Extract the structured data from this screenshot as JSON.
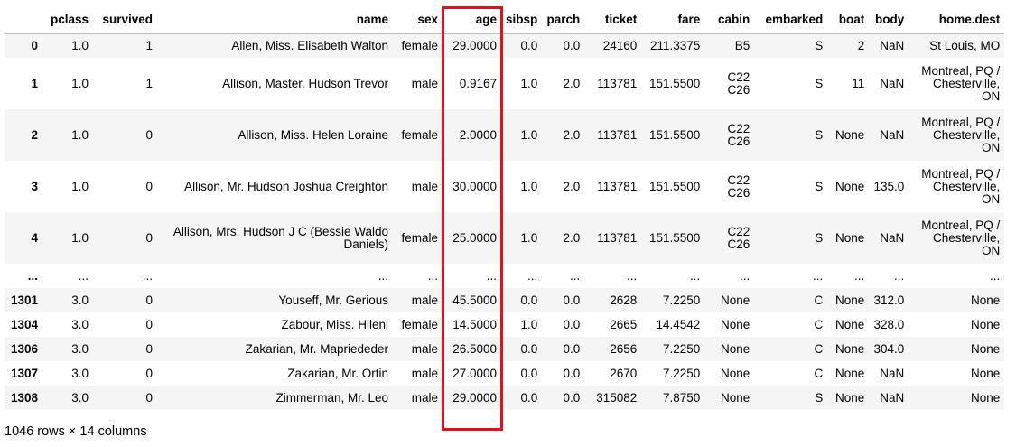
{
  "columns": [
    "",
    "pclass",
    "survived",
    "name",
    "sex",
    "age",
    "sibsp",
    "parch",
    "ticket",
    "fare",
    "cabin",
    "embarked",
    "boat",
    "body",
    "home.dest"
  ],
  "rows": [
    [
      "0",
      "1.0",
      "1",
      "Allen, Miss. Elisabeth Walton",
      "female",
      "29.0000",
      "0.0",
      "0.0",
      "24160",
      "211.3375",
      "B5",
      "S",
      "2",
      "NaN",
      "St Louis, MO"
    ],
    [
      "1",
      "1.0",
      "1",
      "Allison, Master. Hudson Trevor",
      "male",
      "0.9167",
      "1.0",
      "2.0",
      "113781",
      "151.5500",
      "C22 C26",
      "S",
      "11",
      "NaN",
      "Montreal, PQ / Chesterville, ON"
    ],
    [
      "2",
      "1.0",
      "0",
      "Allison, Miss. Helen Loraine",
      "female",
      "2.0000",
      "1.0",
      "2.0",
      "113781",
      "151.5500",
      "C22 C26",
      "S",
      "None",
      "NaN",
      "Montreal, PQ / Chesterville, ON"
    ],
    [
      "3",
      "1.0",
      "0",
      "Allison, Mr. Hudson Joshua Creighton",
      "male",
      "30.0000",
      "1.0",
      "2.0",
      "113781",
      "151.5500",
      "C22 C26",
      "S",
      "None",
      "135.0",
      "Montreal, PQ / Chesterville, ON"
    ],
    [
      "4",
      "1.0",
      "0",
      "Allison, Mrs. Hudson J C (Bessie Waldo Daniels)",
      "female",
      "25.0000",
      "1.0",
      "2.0",
      "113781",
      "151.5500",
      "C22 C26",
      "S",
      "None",
      "NaN",
      "Montreal, PQ / Chesterville, ON"
    ],
    [
      "...",
      "...",
      "...",
      "...",
      "...",
      "...",
      "...",
      "...",
      "...",
      "...",
      "...",
      "...",
      "...",
      "...",
      "..."
    ],
    [
      "1301",
      "3.0",
      "0",
      "Youseff, Mr. Gerious",
      "male",
      "45.5000",
      "0.0",
      "0.0",
      "2628",
      "7.2250",
      "None",
      "C",
      "None",
      "312.0",
      "None"
    ],
    [
      "1304",
      "3.0",
      "0",
      "Zabour, Miss. Hileni",
      "female",
      "14.5000",
      "1.0",
      "0.0",
      "2665",
      "14.4542",
      "None",
      "C",
      "None",
      "328.0",
      "None"
    ],
    [
      "1306",
      "3.0",
      "0",
      "Zakarian, Mr. Mapriededer",
      "male",
      "26.5000",
      "0.0",
      "0.0",
      "2656",
      "7.2250",
      "None",
      "C",
      "None",
      "304.0",
      "None"
    ],
    [
      "1307",
      "3.0",
      "0",
      "Zakarian, Mr. Ortin",
      "male",
      "27.0000",
      "0.0",
      "0.0",
      "2670",
      "7.2250",
      "None",
      "C",
      "None",
      "NaN",
      "None"
    ],
    [
      "1308",
      "3.0",
      "0",
      "Zimmerman, Mr. Leo",
      "male",
      "29.0000",
      "0.0",
      "0.0",
      "315082",
      "7.8750",
      "None",
      "S",
      "None",
      "NaN",
      "None"
    ]
  ],
  "summary": "1046 rows × 14 columns",
  "highlight": {
    "column": "age",
    "color": "#e0101e"
  }
}
